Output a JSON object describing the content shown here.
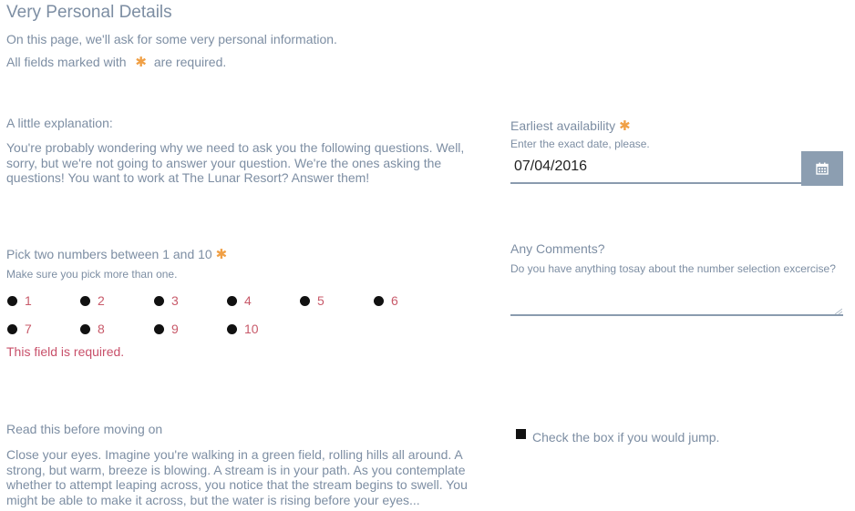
{
  "page": {
    "title": "Very Personal Details",
    "intro": "On this page, we'll ask for some very personal information.",
    "required_prefix": "All fields marked with",
    "required_suffix": "are required.",
    "required_symbol": "✱"
  },
  "explanation": {
    "label": "A little explanation:",
    "text": "You're probably wondering why we need to ask you the following questions. Well, sorry, but we're not going to answer your question. We're the ones asking the questions! You want to work at The Lunar Resort? Answer them!"
  },
  "availability": {
    "label": "Earliest availability",
    "hint": "Enter the exact date, please.",
    "value": "07/04/2016",
    "button_icon": "calendar-icon"
  },
  "numbers": {
    "label": "Pick two numbers between 1 and 10",
    "hint": "Make sure you pick more than one.",
    "options": [
      "1",
      "2",
      "3",
      "4",
      "5",
      "6",
      "7",
      "8",
      "9",
      "10"
    ],
    "error": "This field is required."
  },
  "comments": {
    "label": "Any Comments?",
    "hint": "Do you have anything tosay about the number selection excercise?",
    "value": ""
  },
  "story": {
    "label": "Read this before moving on",
    "text": "Close your eyes. Imagine you're walking in a green field, rolling hills all around. A strong, but warm, breeze is blowing. A stream is in your path. As you contemplate whether to attempt leaping across, you notice that the stream begins to swell. You might be able to make it across, but the water is rising before your eyes..."
  },
  "jump": {
    "label": "Check the box if you would jump."
  },
  "colors": {
    "accent_star": "#f0a046",
    "option_text": "#c85a6a",
    "error_text": "#c8506a",
    "label_text": "#7d8ea3",
    "button_bg": "#8c9eb1"
  }
}
